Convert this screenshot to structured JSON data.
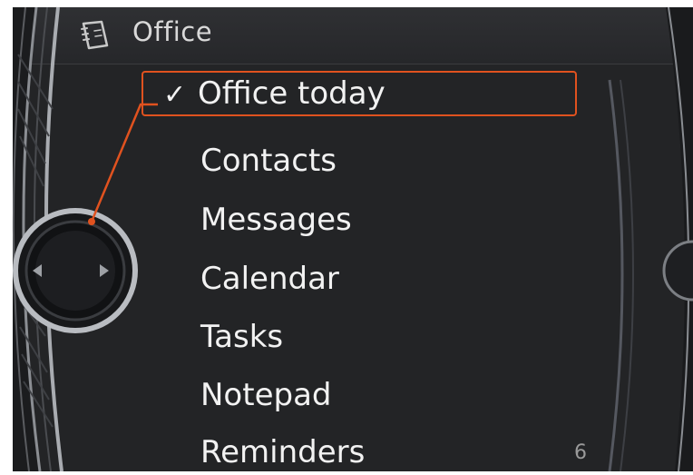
{
  "header": {
    "title": "Office",
    "icon": "notebook-icon"
  },
  "menu": {
    "items": [
      {
        "label": "Office today",
        "selected": true,
        "icon": "checkmark-icon"
      },
      {
        "label": "Contacts"
      },
      {
        "label": "Messages"
      },
      {
        "label": "Calendar"
      },
      {
        "label": "Tasks"
      },
      {
        "label": "Notepad"
      },
      {
        "label": "Reminders"
      }
    ]
  },
  "page_number": "6",
  "colors": {
    "background": "#232426",
    "selection": "#e0521f",
    "text": "#f2f2f2"
  }
}
